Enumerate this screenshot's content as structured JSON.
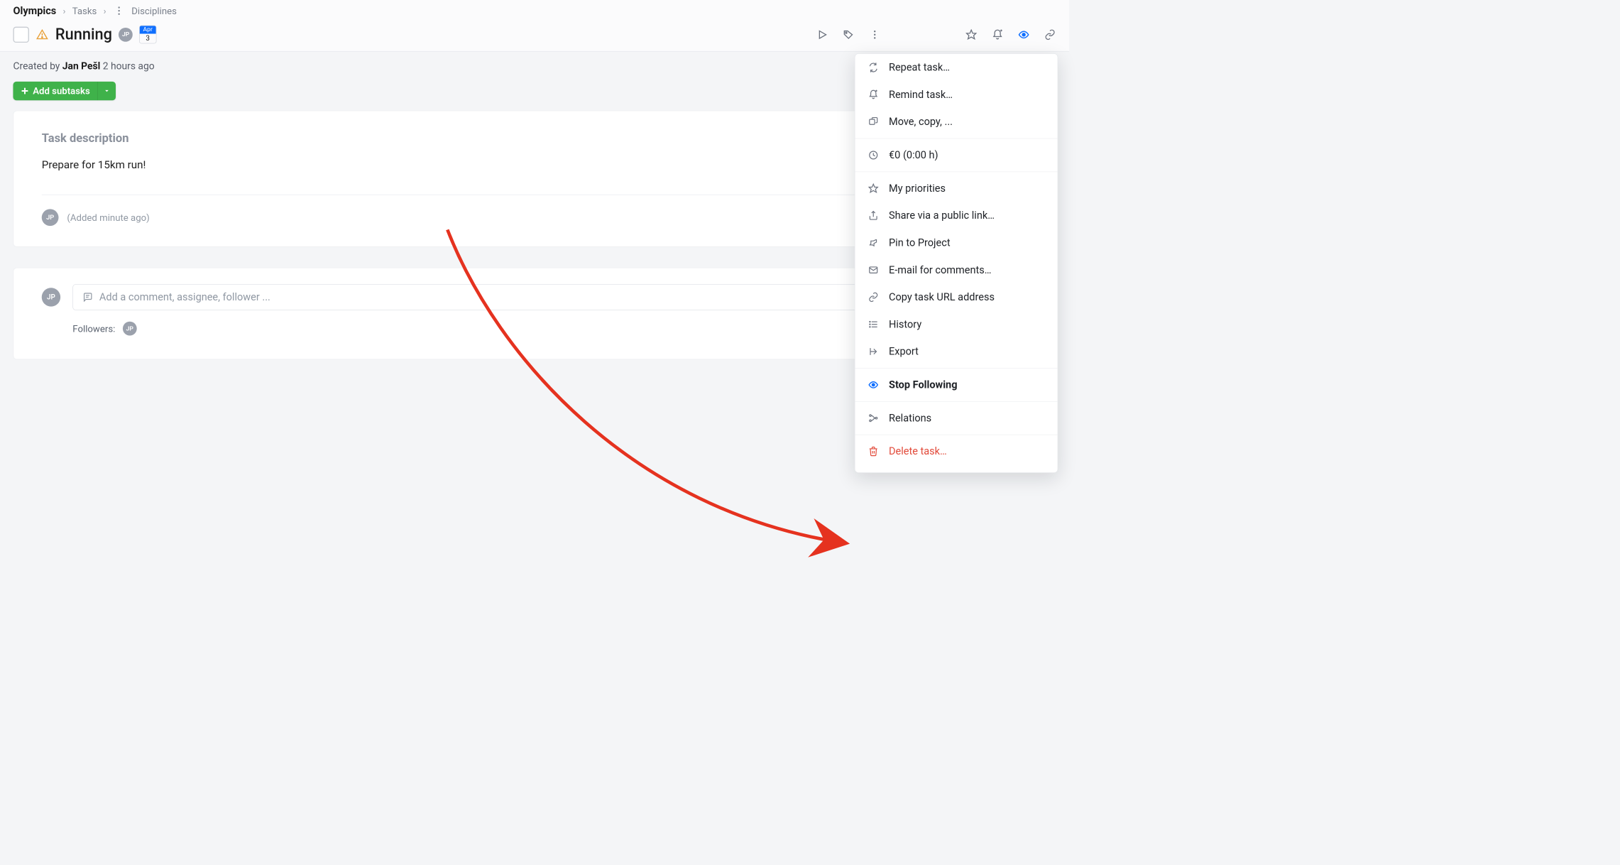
{
  "breadcrumb": {
    "root": "Olympics",
    "level1": "Tasks",
    "level2": "Disciplines"
  },
  "task": {
    "title": "Running",
    "assignee_initials": "JP",
    "date_month": "Apr",
    "date_day": "3"
  },
  "created": {
    "prefix": "Created by ",
    "author": "Jan Pešl",
    "ago": " 2 hours ago"
  },
  "buttons": {
    "add_subtasks": "Add subtasks"
  },
  "description": {
    "heading": "Task description",
    "text": "Prepare for 15km run!",
    "rev_avatar": "JP",
    "rev_text": "(Added minute ago)"
  },
  "comment": {
    "avatar": "JP",
    "placeholder": "Add a comment, assignee, follower ..."
  },
  "followers": {
    "label": "Followers:",
    "avatar": "JP"
  },
  "menu": {
    "repeat": "Repeat task…",
    "remind": "Remind task…",
    "move": "Move, copy, ...",
    "cost": "€0 (0:00 h)",
    "priorities": "My priorities",
    "share": "Share via a public link…",
    "pin": "Pin to Project",
    "email": "E-mail for comments…",
    "copyurl": "Copy task URL address",
    "history": "History",
    "export": "Export",
    "stopfollow": "Stop Following",
    "relations": "Relations",
    "delete": "Delete task…"
  }
}
